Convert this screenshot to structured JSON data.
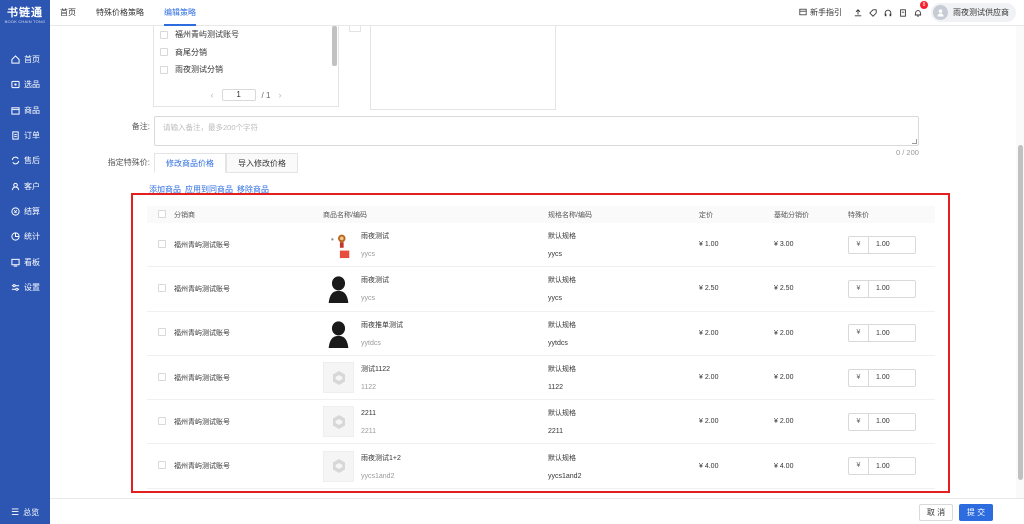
{
  "sidebar": {
    "logo_main": "书链通",
    "logo_sub": "BOOK CHAIN TONG",
    "items": [
      {
        "label": "首页",
        "icon": "home-icon"
      },
      {
        "label": "选品",
        "icon": "select-icon"
      },
      {
        "label": "商品",
        "icon": "goods-icon"
      },
      {
        "label": "订单",
        "icon": "order-icon"
      },
      {
        "label": "售后",
        "icon": "aftersale-icon"
      },
      {
        "label": "客户",
        "icon": "customer-icon"
      },
      {
        "label": "结算",
        "icon": "settle-icon"
      },
      {
        "label": "统计",
        "icon": "stats-icon"
      },
      {
        "label": "看板",
        "icon": "board-icon"
      },
      {
        "label": "设置",
        "icon": "settings-icon"
      }
    ],
    "collapse_label": "总览"
  },
  "header": {
    "tabs": [
      "首页",
      "特殊价格策略",
      "编辑策略"
    ],
    "active_tab": 2,
    "guide_label": "新手指引",
    "notification_count": "8",
    "user_name": "雨夜测试供应商"
  },
  "picker": {
    "items": [
      "福州青屿测试账号",
      "商尾分销",
      "雨夜测试分销"
    ],
    "page_current": "1",
    "page_total": "/ 1"
  },
  "form": {
    "remark_label": "备注:",
    "remark_placeholder": "请输入备注，最多200个字符",
    "remark_counter": "0 / 200",
    "special_label": "指定特殊价:",
    "tabs": [
      "修改商品价格",
      "导入修改价格"
    ],
    "links": [
      "添加商品",
      "应用到同商品",
      "移除商品"
    ]
  },
  "table": {
    "headers": [
      "分销商",
      "商品名称/编码",
      "规格名称/编码",
      "定价",
      "基础分销价",
      "特殊价"
    ],
    "currency_prefix": "¥",
    "rows": [
      {
        "distributor": "福州青屿测试账号",
        "product": "雨夜测试",
        "code": "yycs",
        "spec": "默认规格",
        "spec_code": "yycs",
        "price": "¥ 1.00",
        "base": "¥ 3.00",
        "special": "1.00",
        "thumb": "toy"
      },
      {
        "distributor": "福州青屿测试账号",
        "product": "雨夜测试",
        "code": "yycs",
        "spec": "默认规格",
        "spec_code": "yycs",
        "price": "¥ 2.50",
        "base": "¥ 2.50",
        "special": "1.00",
        "thumb": "dark"
      },
      {
        "distributor": "福州青屿测试账号",
        "product": "雨夜推单测试",
        "code": "yytdcs",
        "spec": "默认规格",
        "spec_code": "yytdcs",
        "price": "¥ 2.00",
        "base": "¥ 2.00",
        "special": "1.00",
        "thumb": "dark"
      },
      {
        "distributor": "福州青屿测试账号",
        "product": "测试1122",
        "code": "1122",
        "spec": "默认规格",
        "spec_code": "1122",
        "price": "¥ 2.00",
        "base": "¥ 2.00",
        "special": "1.00",
        "thumb": "placeholder"
      },
      {
        "distributor": "福州青屿测试账号",
        "product": "2211",
        "code": "2211",
        "spec": "默认规格",
        "spec_code": "2211",
        "price": "¥ 2.00",
        "base": "¥ 2.00",
        "special": "1.00",
        "thumb": "placeholder"
      },
      {
        "distributor": "福州青屿测试账号",
        "product": "雨夜测试1+2",
        "code": "yycs1and2",
        "spec": "默认规格",
        "spec_code": "yycs1and2",
        "price": "¥ 4.00",
        "base": "¥ 4.00",
        "special": "1.00",
        "thumb": "placeholder"
      }
    ]
  },
  "footer": {
    "cancel_label": "取 消",
    "submit_label": "提 交"
  },
  "colors": {
    "sidebar_bg": "#2d56b3",
    "primary": "#2d6cdf",
    "highlight": "#e41f1f"
  }
}
